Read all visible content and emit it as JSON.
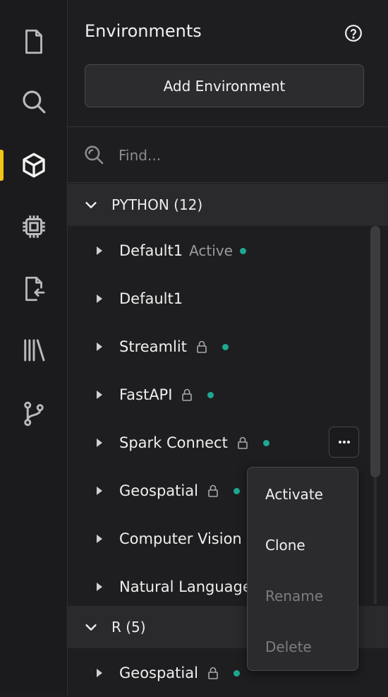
{
  "rail": {
    "items": [
      {
        "icon": "file-icon",
        "active": false
      },
      {
        "icon": "search-icon",
        "active": false
      },
      {
        "icon": "cube-icon",
        "active": true
      },
      {
        "icon": "chip-icon",
        "active": false
      },
      {
        "icon": "file-import-icon",
        "active": false
      },
      {
        "icon": "library-icon",
        "active": false
      },
      {
        "icon": "git-branch-icon",
        "active": false
      }
    ],
    "active_color": "#f0c419"
  },
  "panel": {
    "title": "Environments",
    "help_icon": "help-circle-icon",
    "add_button_label": "Add Environment",
    "search": {
      "placeholder": "Find...",
      "value": ""
    }
  },
  "groups": [
    {
      "label": "PYTHON (12)",
      "expanded": true,
      "items": [
        {
          "name": "Default1",
          "status_label": "Active",
          "locked": false,
          "status_dot": true
        },
        {
          "name": "Default1",
          "locked": false,
          "status_dot": false
        },
        {
          "name": "Streamlit",
          "locked": true,
          "status_dot": true
        },
        {
          "name": "FastAPI",
          "locked": true,
          "status_dot": true
        },
        {
          "name": "Spark Connect",
          "locked": true,
          "status_dot": true
        },
        {
          "name": "Geospatial",
          "locked": true,
          "status_dot": true
        },
        {
          "name": "Computer Vision",
          "locked": false,
          "status_dot": false
        },
        {
          "name": "Natural Language",
          "locked": false,
          "status_dot": false
        }
      ]
    },
    {
      "label": "R (5)",
      "expanded": true,
      "items": [
        {
          "name": "Geospatial",
          "locked": true,
          "status_dot": true
        }
      ]
    }
  ],
  "context_menu": {
    "trigger_label": "···",
    "items": [
      {
        "label": "Activate",
        "enabled": true
      },
      {
        "label": "Clone",
        "enabled": true
      },
      {
        "label": "Rename",
        "enabled": false
      },
      {
        "label": "Delete",
        "enabled": false
      }
    ]
  },
  "colors": {
    "status_dot": "#1fa890",
    "background": "#1e1e20",
    "group_header": "#2a2a2d"
  }
}
